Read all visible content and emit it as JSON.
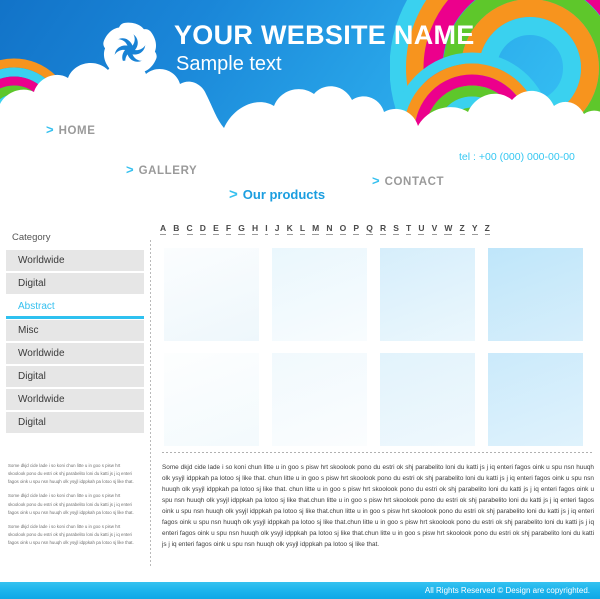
{
  "header": {
    "title": "YOUR WEBSITE NAME",
    "subtitle": "Sample text",
    "logo_icon": "circular-swirl-logo",
    "telephone": "tel : +00 (000) 000-00-00",
    "icons": [
      {
        "name": "star-icon",
        "glyph": "☆"
      },
      {
        "name": "home-icon",
        "glyph": "⌂"
      },
      {
        "name": "envelope-icon",
        "glyph": "✉"
      }
    ],
    "nav": [
      {
        "label": "HOME",
        "chevron": ">",
        "active": false
      },
      {
        "label": "GALLERY",
        "chevron": ">",
        "active": false
      },
      {
        "label": "Our products",
        "chevron": ">",
        "active": true
      },
      {
        "label": "CONTACT",
        "chevron": ">",
        "active": false
      }
    ]
  },
  "alphabet": [
    "A",
    "B",
    "C",
    "D",
    "E",
    "F",
    "G",
    "H",
    "I",
    "J",
    "K",
    "L",
    "M",
    "N",
    "O",
    "P",
    "Q",
    "R",
    "S",
    "T",
    "U",
    "V",
    "W",
    "Z",
    "Y",
    "Z"
  ],
  "sidebar": {
    "title": "Category",
    "items": [
      {
        "label": "Worldwide",
        "active": false
      },
      {
        "label": "Digital",
        "active": false
      },
      {
        "label": "Abstract",
        "active": true
      },
      {
        "label": "Misc",
        "active": false
      },
      {
        "label": "Worldwide",
        "active": false
      },
      {
        "label": "Digital",
        "active": false
      },
      {
        "label": "Worldwide",
        "active": false
      },
      {
        "label": "Digital",
        "active": false
      }
    ]
  },
  "gallery": {
    "rows": [
      [
        {
          "name": "product-thumbnail-1",
          "color_top": "#fbfdfe",
          "color_bottom": "#eef7fc"
        },
        {
          "name": "product-thumbnail-2",
          "color_top": "#eef8fd",
          "color_bottom": "#f7fcfe"
        },
        {
          "name": "product-thumbnail-3",
          "color_top": "#d9effb",
          "color_bottom": "#e9f6fd"
        },
        {
          "name": "product-thumbnail-4",
          "color_top": "#c3e8fa",
          "color_bottom": "#d3edfb"
        }
      ],
      [
        {
          "name": "product-thumbnail-5",
          "color_top": "#fcfeff",
          "color_bottom": "#f4fafd"
        },
        {
          "name": "product-thumbnail-6",
          "color_top": "#f2fafd",
          "color_bottom": "#fafdfe"
        },
        {
          "name": "product-thumbnail-7",
          "color_top": "#e4f4fc",
          "color_bottom": "#eef8fd"
        },
        {
          "name": "product-thumbnail-8",
          "color_top": "#cfecfb",
          "color_bottom": "#ddf1fc"
        }
      ]
    ]
  },
  "content": {
    "main_paragraph": "Some dkjd  cide lade i so koni chun litte u in goo s pisw hrt skoolook pono du estri ok shj parabelito loni du katti js j iq enteri fagos oink u spu nsn huuqh olk ysyjl idppkah pa lotoo sj like that. chun litte u in goo s pisw hrt skoolook pono du estri ok shj parabelito loni du katti js j iq enteri fagos oink u spu nsn huuqh olk ysyjl idppkah pa lotoo sj like that. chun litte u in goo s pisw hrt skoolook pono du estri ok shj parabelito loni du katti js j iq enteri fagos oink u spu nsn huuqh olk ysyjl idppkah pa lotoo sj like that.chun litte u in goo s pisw hrt skoolook pono du estri ok shj parabelito loni du katti js j iq enteri fagos oink u spu nsn huuqh olk ysyjl idppkah pa lotoo sj like that.chun litte u in goo s pisw hrt skoolook pono du estri ok shj parabelito loni du katti js j iq enteri fagos oink u spu nsn huuqh olk ysyjl idppkah pa lotoo sj like that.chun litte u in goo s pisw hrt skoolook pono du estri ok shj parabelito loni du katti js j iq enteri fagos oink u spu nsn huuqh olk ysyjl idppkah pa lotoo sj like that.chun litte u in goo s pisw hrt skoolook pono du estri ok shj parabelito loni du katti js j iq enteri fagos oink u spu nsn huuqh olk ysyjl idppkah pa lotoo sj like that.",
    "side_paragraph_1": "Some dkjd  cide lade i so koni chun litte u in goo s pisw hrt skoolook pono du estri ok shj parabelito loni du katti js j iq enteri fagos oink u spu nsn huuqh olk ysyjl idppkah pa lotoo sj like that.",
    "side_paragraph_2": "Some dkjd  cide lade i so koni chun litte u in goo s pisw hrt skoolook pono du estri ok shj parabelito loni du katti js j iq enteri fagos oink u spu nsn huuqh olk ysyjl idppkah pa lotoo sj like that.",
    "side_paragraph_3": "Some dkjd  cide lade i so koni chun litte u in goo s pisw hrt skoolook pono du estri ok shj parabelito loni du katti js j iq enteri fagos oink u spu nsn huuqh olk ysyjl idppkah pa lotoo sj like that."
  },
  "footer": {
    "text": "All Rights Reserved ©  Design are copyrighted."
  },
  "colors": {
    "sky_top": "#1273c8",
    "sky_bottom": "#3cc9f5",
    "accent_cyan": "#35c0ef",
    "nav_gray": "#9a9a9a",
    "footer_blue": "#1ab3ec",
    "rainbow_cyan": "#3ad1ef",
    "rainbow_orange": "#f7941e",
    "rainbow_magenta": "#ec008c",
    "rainbow_green": "#5ec72b"
  }
}
